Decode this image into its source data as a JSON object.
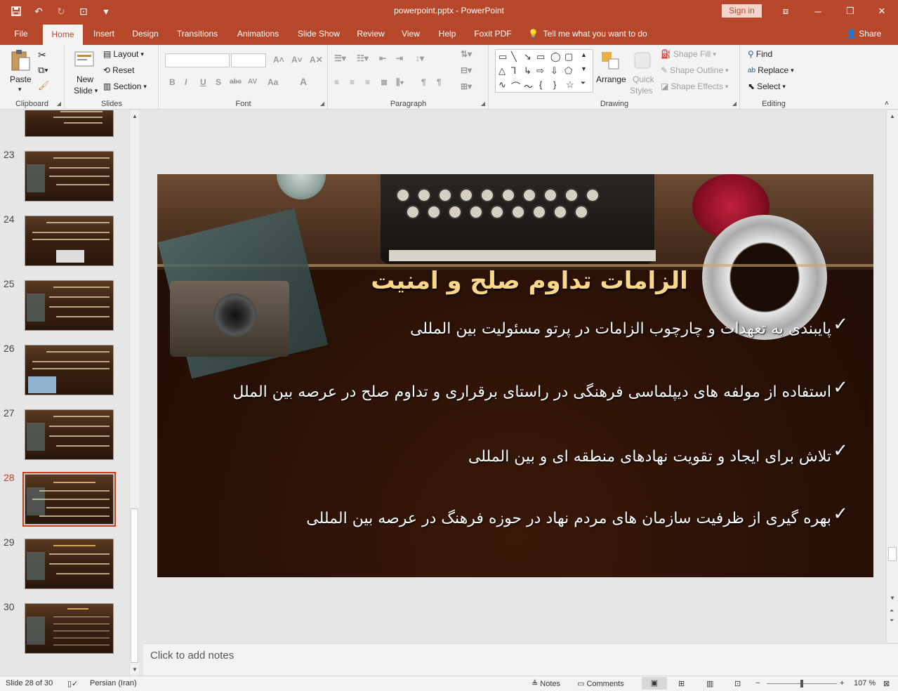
{
  "titlebar": {
    "title": "powerpoint.pptx  -  PowerPoint",
    "signin": "Sign in",
    "qat": {
      "save": "save-icon",
      "undo": "undo-icon",
      "redo": "redo-icon",
      "present": "present-icon",
      "customize": "customize-icon"
    }
  },
  "tabs": [
    "File",
    "Home",
    "Insert",
    "Design",
    "Transitions",
    "Animations",
    "Slide Show",
    "Review",
    "View",
    "Help",
    "Foxit PDF"
  ],
  "tellme": "Tell me what you want to do",
  "share": "Share",
  "ribbon": {
    "clipboard": {
      "label": "Clipboard",
      "paste": "Paste"
    },
    "slides": {
      "label": "Slides",
      "new_slide_1": "New",
      "new_slide_2": "Slide",
      "layout": "Layout",
      "reset": "Reset",
      "section": "Section"
    },
    "font": {
      "label": "Font",
      "bold": "B",
      "italic": "I",
      "underline": "U",
      "shadow": "S",
      "strike": "abc",
      "spacing": "AV",
      "case": "Aa",
      "color": "A"
    },
    "paragraph": {
      "label": "Paragraph"
    },
    "drawing": {
      "label": "Drawing",
      "arrange": "Arrange",
      "quick_styles_1": "Quick",
      "quick_styles_2": "Styles",
      "shape_fill": "Shape Fill",
      "shape_outline": "Shape Outline",
      "shape_effects": "Shape Effects"
    },
    "editing": {
      "label": "Editing",
      "find": "Find",
      "replace": "Replace",
      "select": "Select"
    }
  },
  "thumbnails": {
    "items": [
      {
        "num": "23"
      },
      {
        "num": "24"
      },
      {
        "num": "25"
      },
      {
        "num": "26"
      },
      {
        "num": "27"
      },
      {
        "num": "28"
      },
      {
        "num": "29"
      },
      {
        "num": "30"
      }
    ],
    "active": "28"
  },
  "slide": {
    "title": "الزامات تداوم صلح و امنیت",
    "bullets": [
      "پایبندی به تعهدات و چارچوب الزامات در پرتو مسئولیت بین المللی",
      "استفاده از مولفه های دیپلماسی فرهنگی در راستای برقراری و تداوم صلح در عرصه بین الملل",
      "تلاش برای ایجاد و تقویت نهادهای منطقه ای و بین المللی",
      "بهره گیری از ظرفیت سازمان های مردم نهاد در حوزه فرهنگ در عرصه بین المللی"
    ],
    "check": "✓"
  },
  "notes": {
    "placeholder": "Click to add notes"
  },
  "status": {
    "slide_info": "Slide 28 of 30",
    "language": "Persian (Iran)",
    "notes": "Notes",
    "comments": "Comments",
    "zoom": "107 %"
  }
}
